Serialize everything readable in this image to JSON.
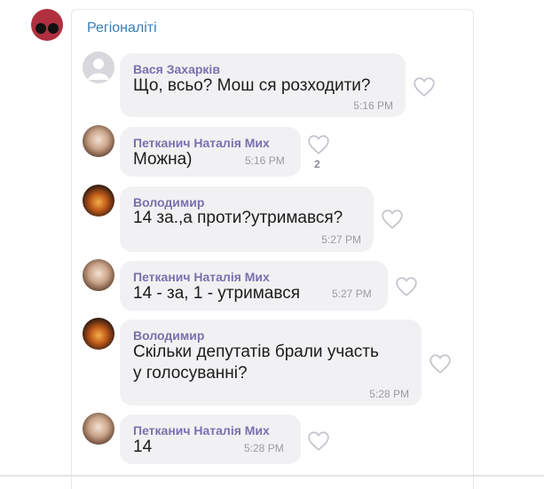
{
  "chat": {
    "title": "Регіоналіті"
  },
  "messages": [
    {
      "sender": "Вася Захарків",
      "text": "Що, всьо? Мош ся розходити?",
      "time": "5:16 PM",
      "likes": ""
    },
    {
      "sender": "Петканич Наталія Мих",
      "text": "Можна)",
      "time": "5:16 PM",
      "likes": "2"
    },
    {
      "sender": "Володимир",
      "text": "14 за.,а проти?утримався?",
      "time": "5:27 PM",
      "likes": ""
    },
    {
      "sender": "Петканич Наталія Мих",
      "text": "14 - за, 1 - утримався",
      "time": "5:27 PM",
      "likes": ""
    },
    {
      "sender": "Володимир",
      "text_line1": "Скільки депутатів брали участь",
      "text_line2": "у голосуванні?",
      "time": "5:28 PM",
      "likes": ""
    },
    {
      "sender": "Петканич Наталія Мих",
      "text": "14",
      "time": "5:28 PM",
      "likes": ""
    }
  ],
  "icons": {
    "like": "heart-icon"
  },
  "colors": {
    "sender": "#7c6fae",
    "title": "#3a7db5",
    "bubble": "#f1f1f3"
  }
}
